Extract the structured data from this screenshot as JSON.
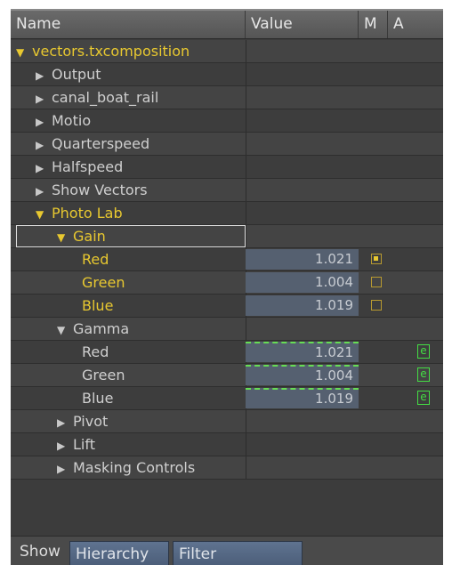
{
  "header": {
    "name": "Name",
    "value": "Value",
    "m": "M",
    "a": "A"
  },
  "rows": [
    {
      "label": "vectors.txcomposition",
      "indent": 0,
      "expanded": true,
      "yellow": true
    },
    {
      "label": "Output",
      "indent": 1,
      "expanded": false,
      "yellow": false
    },
    {
      "label": "canal_boat_rail",
      "indent": 1,
      "expanded": false,
      "yellow": false
    },
    {
      "label": "Motio",
      "indent": 1,
      "expanded": false,
      "yellow": false
    },
    {
      "label": "Quarterspeed",
      "indent": 1,
      "expanded": false,
      "yellow": false
    },
    {
      "label": "Halfspeed",
      "indent": 1,
      "expanded": false,
      "yellow": false
    },
    {
      "label": "Show Vectors",
      "indent": 1,
      "expanded": false,
      "yellow": false
    },
    {
      "label": "Photo Lab",
      "indent": 1,
      "expanded": true,
      "yellow": true
    },
    {
      "label": "Gain",
      "indent": 2,
      "expanded": true,
      "yellow": true,
      "selected": true
    },
    {
      "label": "Red",
      "indent": 3,
      "yellow": true,
      "value": "1.021",
      "m": "checked"
    },
    {
      "label": "Green",
      "indent": 3,
      "yellow": true,
      "value": "1.004",
      "m": "unchecked"
    },
    {
      "label": "Blue",
      "indent": 3,
      "yellow": true,
      "value": "1.019",
      "m": "unchecked"
    },
    {
      "label": "Gamma",
      "indent": 2,
      "expanded": true,
      "yellow": false
    },
    {
      "label": "Red",
      "indent": 3,
      "yellow": false,
      "value": "1.021",
      "animated": true,
      "a_icon": "e"
    },
    {
      "label": "Green",
      "indent": 3,
      "yellow": false,
      "value": "1.004",
      "animated": true,
      "a_icon": "e"
    },
    {
      "label": "Blue",
      "indent": 3,
      "yellow": false,
      "value": "1.019",
      "animated": true,
      "a_icon": "e"
    },
    {
      "label": "Pivot",
      "indent": 2,
      "expanded": false,
      "yellow": false
    },
    {
      "label": "Lift",
      "indent": 2,
      "expanded": false,
      "yellow": false
    },
    {
      "label": "Masking Controls",
      "indent": 2,
      "expanded": false,
      "yellow": false
    }
  ],
  "footer": {
    "show_label": "Show",
    "hierarchy_button": "Hierarchy",
    "filter_button": "Filter"
  },
  "colors": {
    "highlight_text": "#e8c830",
    "normal_text": "#cfcfcf",
    "animated_marker": "#44dd44",
    "value_cell": "#556070"
  },
  "icons": {
    "collapsed": "triangle-right-icon",
    "expanded": "triangle-down-icon",
    "animation": "expression-icon"
  }
}
